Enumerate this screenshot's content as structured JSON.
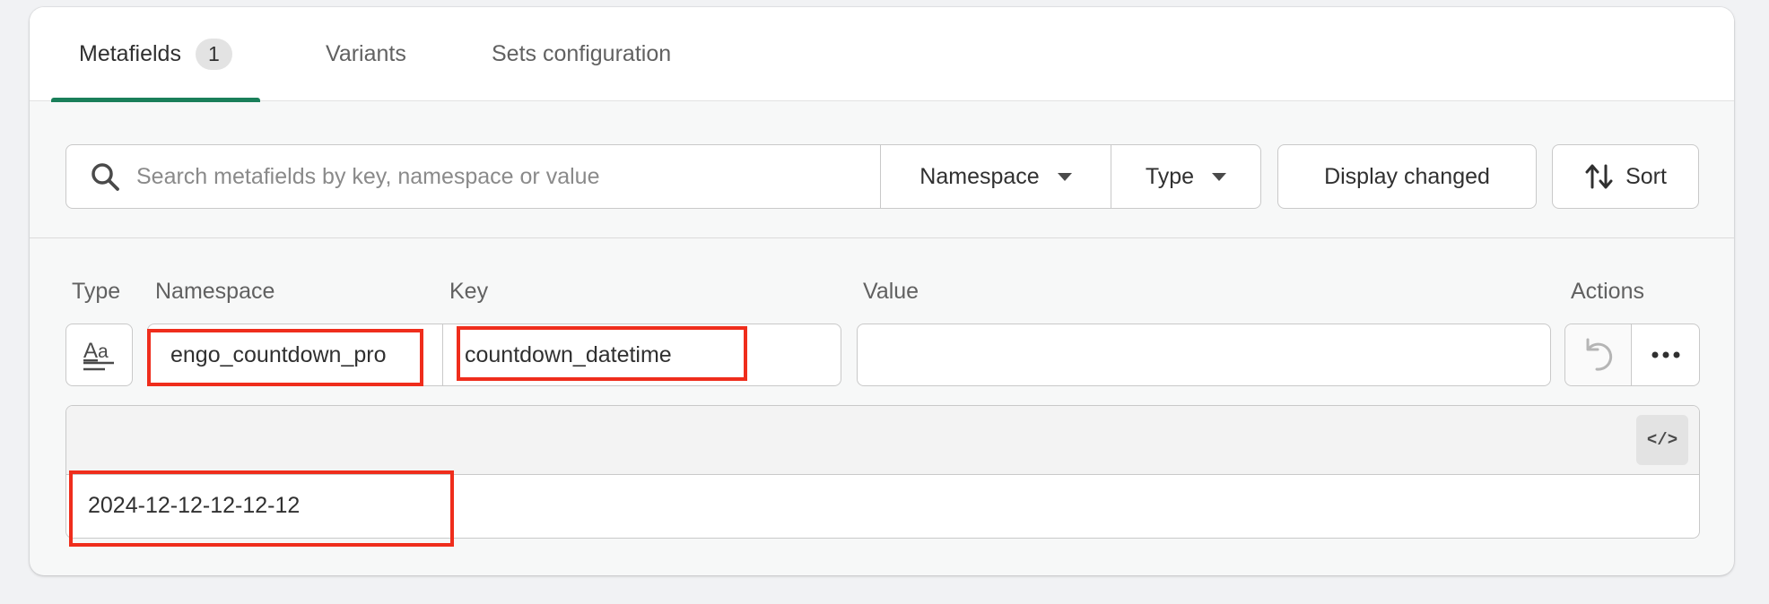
{
  "tabs": [
    {
      "label": "Metafields",
      "badge": "1"
    },
    {
      "label": "Variants"
    },
    {
      "label": "Sets configuration"
    }
  ],
  "search": {
    "placeholder": "Search metafields by key, namespace or value"
  },
  "filters": {
    "namespace_label": "Namespace",
    "type_label": "Type"
  },
  "buttons": {
    "display_changed": "Display changed",
    "sort": "Sort"
  },
  "table": {
    "headers": {
      "type": "Type",
      "namespace": "Namespace",
      "key": "Key",
      "value": "Value",
      "actions": "Actions"
    },
    "row": {
      "type_icon": "text-type-icon",
      "namespace": "engo_countdown_pro",
      "key": "countdown_datetime",
      "value": "2024-12-12-12-12-12"
    }
  },
  "colors": {
    "accent": "#1a7f5a",
    "highlight": "#ef2d1c"
  }
}
